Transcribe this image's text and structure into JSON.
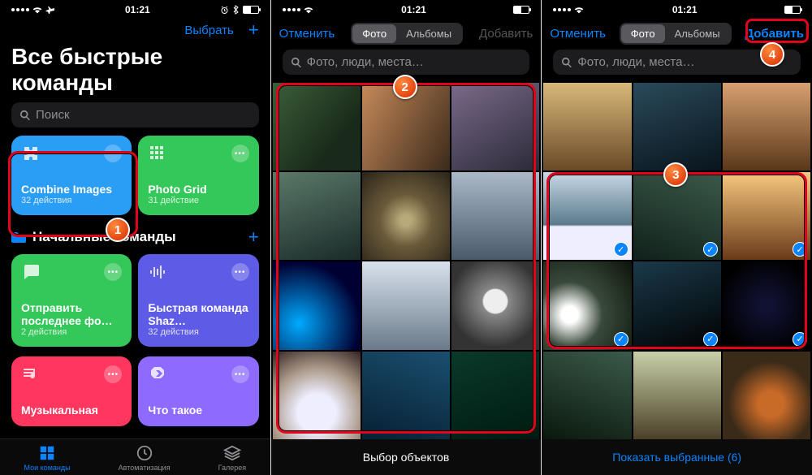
{
  "status": {
    "time": "01:21"
  },
  "screen1": {
    "select": "Выбрать",
    "title": "Все быстрые команды",
    "search_placeholder": "Поиск",
    "section_starter": "Начальные команды",
    "cards": [
      {
        "name": "Combine Images",
        "sub": "32 действия",
        "color": "#2a9df4"
      },
      {
        "name": "Photo Grid",
        "sub": "31 действие",
        "color": "#34c759"
      },
      {
        "name": "Отправить последнее фо…",
        "sub": "2 действия",
        "color": "#34c759"
      },
      {
        "name": "Быстрая команда Shaz…",
        "sub": "32 действия",
        "color": "#5e5ce6"
      },
      {
        "name": "Музыкальная",
        "sub": "",
        "color": "#ff375f"
      },
      {
        "name": "Что такое",
        "sub": "",
        "color": "#8e6aff"
      }
    ],
    "tabs": {
      "mine": "Мои команды",
      "auto": "Автоматизация",
      "gallery": "Галерея"
    }
  },
  "picker": {
    "cancel": "Отменить",
    "seg_photos": "Фото",
    "seg_albums": "Альбомы",
    "add": "Добавить",
    "search_placeholder": "Фото, люди, места…",
    "footer_select": "Выбор объектов",
    "footer_show_selected": "Показать выбранные (6)"
  },
  "callouts": {
    "c1": "1",
    "c2": "2",
    "c3": "3",
    "c4": "4"
  }
}
